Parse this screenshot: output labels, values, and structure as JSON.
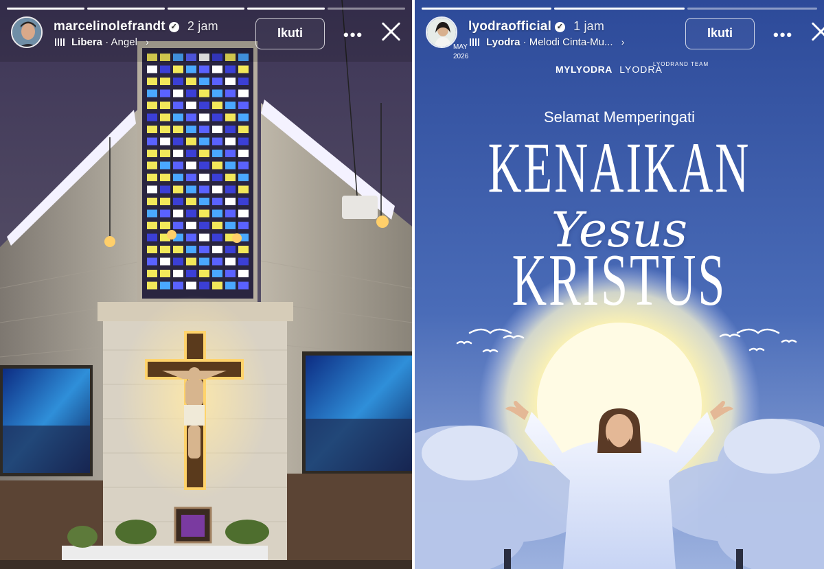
{
  "stories": [
    {
      "username": "marcelinolefrandt",
      "verified_mark": "✓",
      "time": "2 jam",
      "music_artist": "Libera",
      "music_title": "Angel",
      "separator": "·",
      "follow_label": "Ikuti",
      "more_icon": "ellipsis-icon",
      "progress_segments": 5,
      "progress_filled": 4
    },
    {
      "username": "lyodraofficial",
      "verified_mark": "✓",
      "time": "1 jam",
      "music_artist": "Lyodra",
      "music_title": "Melodi Cinta-Mu...",
      "separator": "·",
      "follow_label": "Ikuti",
      "more_icon": "ellipsis-icon",
      "date_stamp_month": "MAY",
      "date_stamp_year": "2026",
      "progress_segments": 3,
      "progress_filled": 2,
      "poster": {
        "logo_1": "MYLYODRA",
        "logo_2": "LYODRA",
        "logo_3": "LYODRAND TEAM",
        "greeting": "Selamat Memperingati",
        "line_1": "KENAIKAN",
        "line_2": "Yesus",
        "line_3": "KRISTUS"
      }
    }
  ],
  "colors": {
    "poster_bg_top": "#2f4f9f",
    "poster_bg_bottom": "#8fa8d8",
    "church_wall": "#d9d2c4",
    "cross_glow": "#ffd36b"
  }
}
